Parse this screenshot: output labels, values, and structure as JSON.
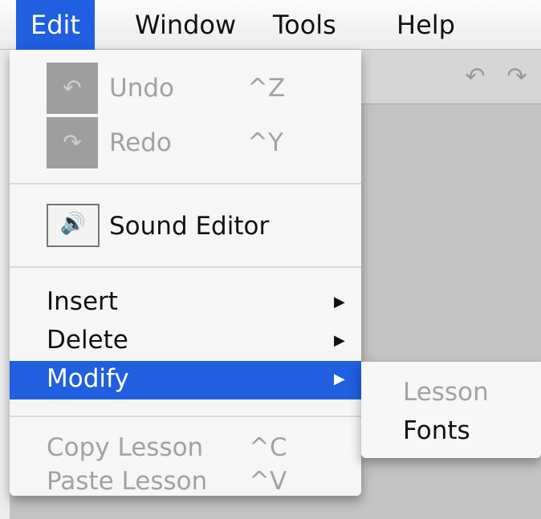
{
  "menubar": {
    "items": [
      {
        "label": "Edit",
        "active": true
      },
      {
        "label": "Window"
      },
      {
        "label": "Tools"
      },
      {
        "label": "Help"
      }
    ]
  },
  "toolbar": {
    "icons": [
      "undo-icon",
      "redo-icon"
    ]
  },
  "edit_menu": {
    "undo": {
      "label": "Undo",
      "shortcut": "^Z",
      "icon": "undo-icon",
      "enabled": false
    },
    "redo": {
      "label": "Redo",
      "shortcut": "^Y",
      "icon": "redo-icon",
      "enabled": false
    },
    "sound_editor": {
      "label": "Sound Editor",
      "icon": "speaker-icon",
      "enabled": true
    },
    "insert": {
      "label": "Insert",
      "has_submenu": true
    },
    "delete": {
      "label": "Delete",
      "has_submenu": true
    },
    "modify": {
      "label": "Modify",
      "has_submenu": true,
      "selected": true
    },
    "copy_lesson": {
      "label": "Copy Lesson",
      "shortcut": "^C",
      "enabled": false
    },
    "paste_lesson": {
      "label": "Paste Lesson",
      "shortcut": "^V",
      "enabled": false
    }
  },
  "modify_submenu": {
    "items": [
      {
        "label": "Lesson",
        "enabled": false
      },
      {
        "label": "Fonts",
        "enabled": true
      }
    ]
  },
  "colors": {
    "selection": "#1f5fe0",
    "disabled_text": "#a2a2a2"
  }
}
